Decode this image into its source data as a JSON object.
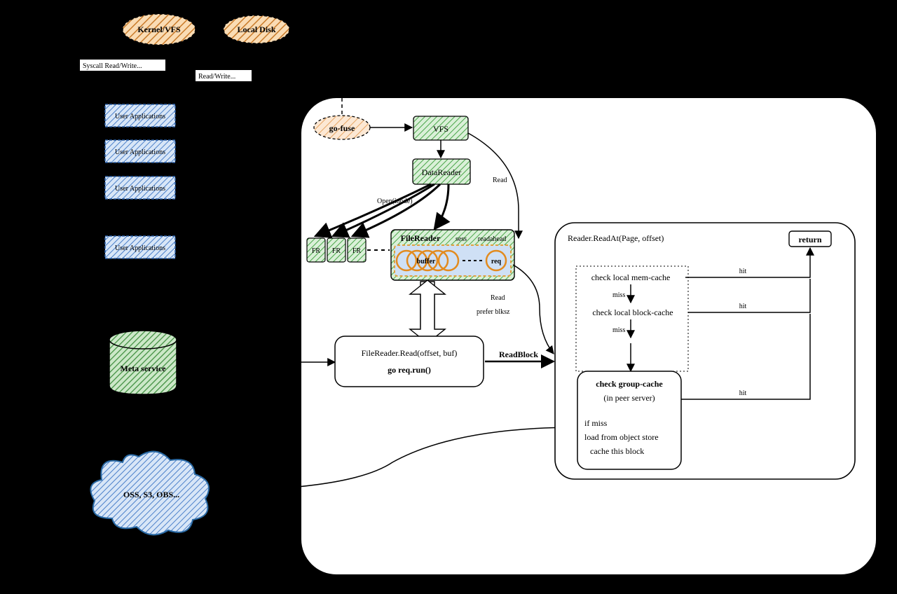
{
  "top_ellipses": {
    "kernel": "Kernel/VFS",
    "local": "Local Disk"
  },
  "top_labels": {
    "syscall": "Syscall Read/Write...",
    "readwrite": "Read/Write..."
  },
  "userapps": [
    "User Applications",
    "User Applications",
    "User Applications",
    "User Applications"
  ],
  "meta_service": "Meta service",
  "object_store": "OSS, S3, OBS...",
  "go_fuse": "go-fuse",
  "vfs": "VFS",
  "data_reader": "DataReader",
  "open_label": "Open(inode)",
  "read_label": "Read",
  "fr": "FR",
  "filereader": {
    "title": "FileReader",
    "sess": "sess",
    "readahead": "readahead",
    "buffer": "buffer",
    "req": "req"
  },
  "frread": {
    "line1": "FileReader.Read(offset, buf)",
    "line2": "go req.run()"
  },
  "read2": "Read",
  "prefer": "prefer blksz",
  "readblock": "ReadBlock",
  "reader_box": {
    "title": "Reader.ReadAt(Page, offset)",
    "return": "return",
    "check_mem": "check local mem-cache",
    "check_block": "check local block-cache",
    "check_group": {
      "title": "check group-cache",
      "sub": "(in peer server)",
      "miss": "if miss",
      "load": "load from object store",
      "cache": "cache this block"
    },
    "hit": "hit",
    "miss": "miss"
  }
}
